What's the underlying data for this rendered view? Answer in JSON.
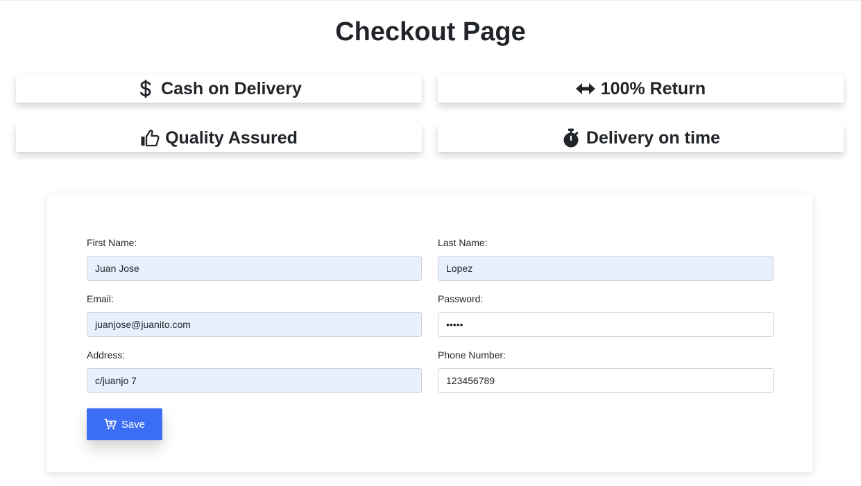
{
  "page": {
    "title": "Checkout Page"
  },
  "features": {
    "cod": {
      "label": "Cash on Delivery",
      "icon": "dollar-icon"
    },
    "return": {
      "label": "100% Return",
      "icon": "arrows-left-right-icon"
    },
    "quality": {
      "label": "Quality Assured",
      "icon": "thumbs-up-icon"
    },
    "delivery": {
      "label": "Delivery on time",
      "icon": "stopwatch-icon"
    }
  },
  "form": {
    "first_name": {
      "label": "First Name:",
      "value": "Juan Jose"
    },
    "last_name": {
      "label": "Last Name:",
      "value": "Lopez"
    },
    "email": {
      "label": "Email:",
      "value": "juanjose@juanito.com"
    },
    "password": {
      "label": "Password:",
      "value": "•••••"
    },
    "address": {
      "label": "Address:",
      "value": "c/juanjo 7"
    },
    "phone": {
      "label": "Phone Number:",
      "value": "123456789"
    },
    "save_label": "Save",
    "save_icon": "cart-plus-icon"
  },
  "colors": {
    "primary_button": "#3b6ef5",
    "autofill_background": "#e8f0fe",
    "text": "#212529"
  }
}
